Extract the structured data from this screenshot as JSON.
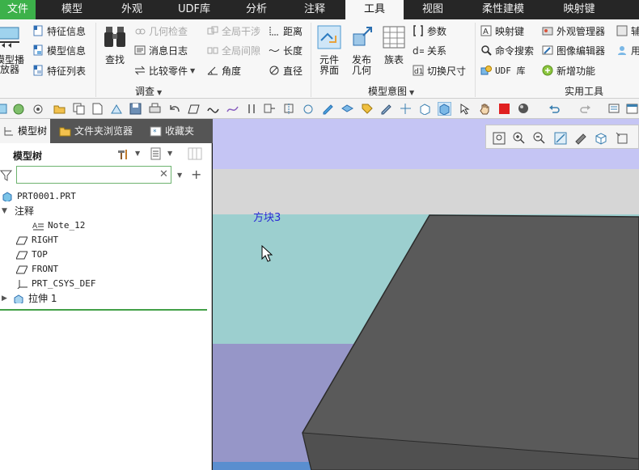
{
  "menu_tabs": [
    "文件",
    "模型",
    "外观",
    "UDF库",
    "分析",
    "注释",
    "工具",
    "视图",
    "柔性建模",
    "映射键"
  ],
  "active_tab": "工具",
  "ribbon": {
    "model_player": "模型播\n放器",
    "feature_info": "特征信息",
    "model_info": "模型信息",
    "feature_list": "特征列表",
    "find": "查找",
    "geometry_check": "几何检查",
    "message_log": "消息日志",
    "compare_part": "比较零件",
    "global_interference": "全局干涉",
    "global_clearance": "全局间隙",
    "angle": "角度",
    "distance": "距离",
    "length": "长度",
    "diameter": "直径",
    "group_investigate": "调查",
    "component_interface": "元件\n界面",
    "publish_geometry": "发布\n几何",
    "family_table": "族表",
    "parameters": "参数",
    "relations": "关系",
    "switch_dimensions": "切换尺寸",
    "group_model_intent": "模型意图",
    "mapkeys": "映射键",
    "command_search": "命令搜索",
    "udf_library": "UDF 库",
    "appearance_manager": "外观管理器",
    "image_editor": "图像编辑器",
    "new_features": "新增功能",
    "aux_cut": "辅",
    "use_cut": "用",
    "group_utilities": "实用工具"
  },
  "left_panel": {
    "tabs": [
      "模型树",
      "文件夹浏览器",
      "收藏夹"
    ],
    "tree_title": "模型树",
    "search_value": "",
    "tree_items": [
      {
        "label": "PRT0001.PRT",
        "icon": "part-icon",
        "level": 0
      },
      {
        "label": "注释",
        "icon": "folder-expanded",
        "level": 0
      },
      {
        "label": "Note_12",
        "icon": "note-icon",
        "level": 2
      },
      {
        "label": "RIGHT",
        "icon": "datum-plane-icon",
        "level": 1
      },
      {
        "label": "TOP",
        "icon": "datum-plane-icon",
        "level": 1
      },
      {
        "label": "FRONT",
        "icon": "datum-plane-icon",
        "level": 1
      },
      {
        "label": "PRT_CSYS_DEF",
        "icon": "csys-icon",
        "level": 1
      },
      {
        "label": "拉伸 1",
        "icon": "extrude-icon",
        "level": 0
      }
    ]
  },
  "viewport": {
    "annotation": "方块3"
  },
  "colors": {
    "accent_green": "#3cb14a",
    "dark_bar": "#262626",
    "block": "#5a5a5a",
    "annotation_text": "#2b2bd6"
  }
}
